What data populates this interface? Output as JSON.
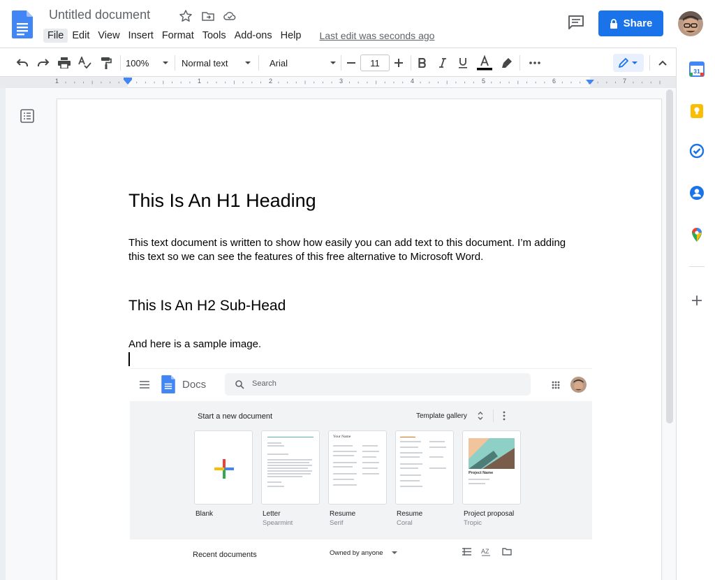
{
  "header": {
    "title": "Untitled document",
    "menu": [
      "File",
      "Edit",
      "View",
      "Insert",
      "Format",
      "Tools",
      "Add-ons",
      "Help"
    ],
    "last_edit": "Last edit was seconds ago",
    "share_label": "Share"
  },
  "toolbar": {
    "zoom": "100%",
    "style": "Normal text",
    "font": "Arial",
    "font_size": "11"
  },
  "ruler": {
    "labels": [
      "1",
      "1",
      "2",
      "3",
      "4",
      "5",
      "6",
      "7"
    ]
  },
  "side_panel": {
    "calendar_day": "31"
  },
  "document": {
    "h1": "This Is An H1 Heading",
    "paragraph": "This text document is written to show how easily you can add text to this document. I’m adding this text so we can see the features of this free alternative to Microsoft Word.",
    "h2": "This Is An H2 Sub-Head",
    "paragraph2": "And here is a sample image."
  },
  "embed": {
    "app_name": "Docs",
    "search_placeholder": "Search",
    "start_label": "Start a new document",
    "gallery_label": "Template gallery",
    "templates": [
      {
        "name": "Blank",
        "sub": ""
      },
      {
        "name": "Letter",
        "sub": "Spearmint"
      },
      {
        "name": "Resume",
        "sub": "Serif"
      },
      {
        "name": "Resume",
        "sub": "Coral"
      },
      {
        "name": "Project proposal",
        "sub": "Tropic"
      }
    ],
    "resume_card_title": "Your Name",
    "proposal_card_title": "Project Name",
    "recent_label": "Recent documents",
    "owned_label": "Owned by anyone"
  },
  "colors": {
    "accent": "#1a73e8",
    "docs_blue": "#4285f4"
  }
}
